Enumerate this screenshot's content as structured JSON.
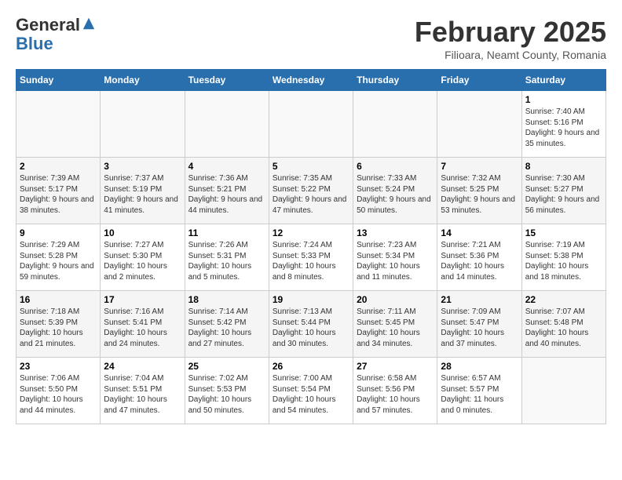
{
  "logo": {
    "general": "General",
    "blue": "Blue"
  },
  "header": {
    "month": "February 2025",
    "location": "Filioara, Neamt County, Romania"
  },
  "weekdays": [
    "Sunday",
    "Monday",
    "Tuesday",
    "Wednesday",
    "Thursday",
    "Friday",
    "Saturday"
  ],
  "weeks": [
    [
      {
        "day": "",
        "info": ""
      },
      {
        "day": "",
        "info": ""
      },
      {
        "day": "",
        "info": ""
      },
      {
        "day": "",
        "info": ""
      },
      {
        "day": "",
        "info": ""
      },
      {
        "day": "",
        "info": ""
      },
      {
        "day": "1",
        "info": "Sunrise: 7:40 AM\nSunset: 5:16 PM\nDaylight: 9 hours and 35 minutes."
      }
    ],
    [
      {
        "day": "2",
        "info": "Sunrise: 7:39 AM\nSunset: 5:17 PM\nDaylight: 9 hours and 38 minutes."
      },
      {
        "day": "3",
        "info": "Sunrise: 7:37 AM\nSunset: 5:19 PM\nDaylight: 9 hours and 41 minutes."
      },
      {
        "day": "4",
        "info": "Sunrise: 7:36 AM\nSunset: 5:21 PM\nDaylight: 9 hours and 44 minutes."
      },
      {
        "day": "5",
        "info": "Sunrise: 7:35 AM\nSunset: 5:22 PM\nDaylight: 9 hours and 47 minutes."
      },
      {
        "day": "6",
        "info": "Sunrise: 7:33 AM\nSunset: 5:24 PM\nDaylight: 9 hours and 50 minutes."
      },
      {
        "day": "7",
        "info": "Sunrise: 7:32 AM\nSunset: 5:25 PM\nDaylight: 9 hours and 53 minutes."
      },
      {
        "day": "8",
        "info": "Sunrise: 7:30 AM\nSunset: 5:27 PM\nDaylight: 9 hours and 56 minutes."
      }
    ],
    [
      {
        "day": "9",
        "info": "Sunrise: 7:29 AM\nSunset: 5:28 PM\nDaylight: 9 hours and 59 minutes."
      },
      {
        "day": "10",
        "info": "Sunrise: 7:27 AM\nSunset: 5:30 PM\nDaylight: 10 hours and 2 minutes."
      },
      {
        "day": "11",
        "info": "Sunrise: 7:26 AM\nSunset: 5:31 PM\nDaylight: 10 hours and 5 minutes."
      },
      {
        "day": "12",
        "info": "Sunrise: 7:24 AM\nSunset: 5:33 PM\nDaylight: 10 hours and 8 minutes."
      },
      {
        "day": "13",
        "info": "Sunrise: 7:23 AM\nSunset: 5:34 PM\nDaylight: 10 hours and 11 minutes."
      },
      {
        "day": "14",
        "info": "Sunrise: 7:21 AM\nSunset: 5:36 PM\nDaylight: 10 hours and 14 minutes."
      },
      {
        "day": "15",
        "info": "Sunrise: 7:19 AM\nSunset: 5:38 PM\nDaylight: 10 hours and 18 minutes."
      }
    ],
    [
      {
        "day": "16",
        "info": "Sunrise: 7:18 AM\nSunset: 5:39 PM\nDaylight: 10 hours and 21 minutes."
      },
      {
        "day": "17",
        "info": "Sunrise: 7:16 AM\nSunset: 5:41 PM\nDaylight: 10 hours and 24 minutes."
      },
      {
        "day": "18",
        "info": "Sunrise: 7:14 AM\nSunset: 5:42 PM\nDaylight: 10 hours and 27 minutes."
      },
      {
        "day": "19",
        "info": "Sunrise: 7:13 AM\nSunset: 5:44 PM\nDaylight: 10 hours and 30 minutes."
      },
      {
        "day": "20",
        "info": "Sunrise: 7:11 AM\nSunset: 5:45 PM\nDaylight: 10 hours and 34 minutes."
      },
      {
        "day": "21",
        "info": "Sunrise: 7:09 AM\nSunset: 5:47 PM\nDaylight: 10 hours and 37 minutes."
      },
      {
        "day": "22",
        "info": "Sunrise: 7:07 AM\nSunset: 5:48 PM\nDaylight: 10 hours and 40 minutes."
      }
    ],
    [
      {
        "day": "23",
        "info": "Sunrise: 7:06 AM\nSunset: 5:50 PM\nDaylight: 10 hours and 44 minutes."
      },
      {
        "day": "24",
        "info": "Sunrise: 7:04 AM\nSunset: 5:51 PM\nDaylight: 10 hours and 47 minutes."
      },
      {
        "day": "25",
        "info": "Sunrise: 7:02 AM\nSunset: 5:53 PM\nDaylight: 10 hours and 50 minutes."
      },
      {
        "day": "26",
        "info": "Sunrise: 7:00 AM\nSunset: 5:54 PM\nDaylight: 10 hours and 54 minutes."
      },
      {
        "day": "27",
        "info": "Sunrise: 6:58 AM\nSunset: 5:56 PM\nDaylight: 10 hours and 57 minutes."
      },
      {
        "day": "28",
        "info": "Sunrise: 6:57 AM\nSunset: 5:57 PM\nDaylight: 11 hours and 0 minutes."
      },
      {
        "day": "",
        "info": ""
      }
    ]
  ]
}
